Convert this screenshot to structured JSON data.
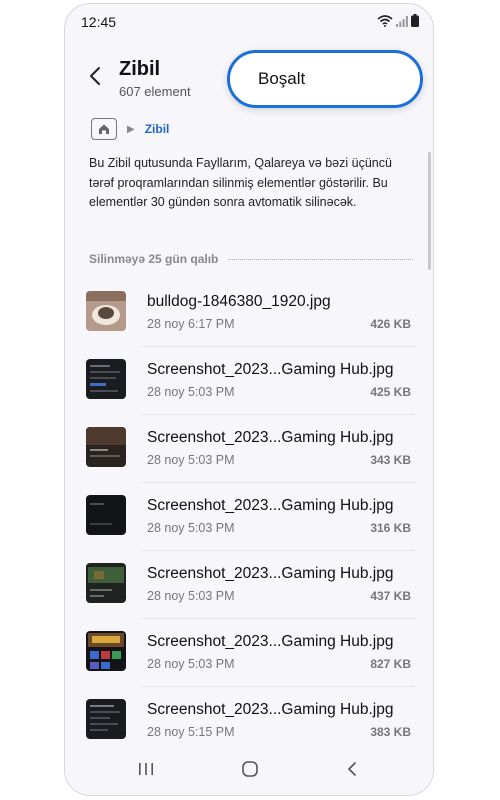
{
  "status_bar": {
    "time": "12:45"
  },
  "header": {
    "title": "Zibil",
    "subtitle": "607 element",
    "empty_button_label": "Boşalt"
  },
  "breadcrumb": {
    "current": "Zibil"
  },
  "info_text": "Bu Zibil qutusunda Fayllarım, Qalareya və bəzi üçüncü tərəf proqramlarından silinmiş elementlər göstərilir. Bu elementlər 30 gündən sonra avtomatik silinəcək.",
  "section": {
    "label": "Silinməyə 25 gün qalıb"
  },
  "files": [
    {
      "name": "bulldog-1846380_1920.jpg",
      "date": "28 noy 6:17 PM",
      "size": "426 KB"
    },
    {
      "name": "Screenshot_2023...Gaming Hub.jpg",
      "date": "28 noy 5:03 PM",
      "size": "425 KB"
    },
    {
      "name": "Screenshot_2023...Gaming Hub.jpg",
      "date": "28 noy 5:03 PM",
      "size": "343 KB"
    },
    {
      "name": "Screenshot_2023...Gaming Hub.jpg",
      "date": "28 noy 5:03 PM",
      "size": "316 KB"
    },
    {
      "name": "Screenshot_2023...Gaming Hub.jpg",
      "date": "28 noy 5:03 PM",
      "size": "437 KB"
    },
    {
      "name": "Screenshot_2023...Gaming Hub.jpg",
      "date": "28 noy 5:03 PM",
      "size": "827 KB"
    },
    {
      "name": "Screenshot_2023...Gaming Hub.jpg",
      "date": "28 noy 5:15 PM",
      "size": "383 KB"
    }
  ],
  "icons": {
    "back": "chevron-left-icon",
    "home": "home-icon",
    "wifi": "wifi-icon",
    "signal": "signal-icon",
    "battery": "battery-icon",
    "nav_recents": "recents-icon",
    "nav_home": "home-circle-icon",
    "nav_back": "nav-back-icon"
  },
  "colors": {
    "accent": "#1a6fd8",
    "breadcrumb": "#2166c7",
    "background": "#f7f6fa"
  }
}
